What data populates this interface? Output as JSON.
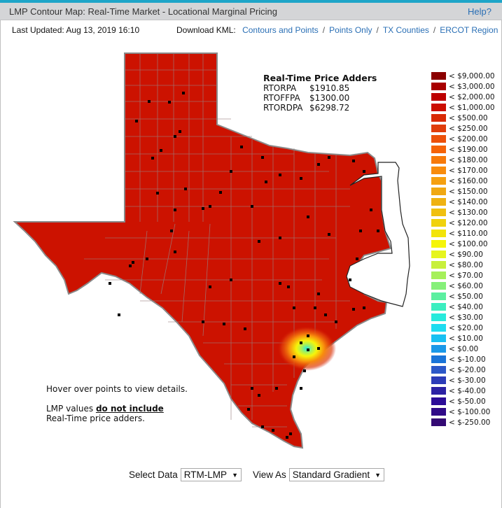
{
  "header": {
    "title": "LMP Contour Map: Real-Time Market - Locational Marginal Pricing",
    "help_label": "Help?"
  },
  "info": {
    "last_updated": "Last Updated: Aug 13, 2019 16:10",
    "download_label": "Download KML:",
    "links": [
      "Contours and Points",
      "Points Only",
      "TX Counties",
      "ERCOT Region"
    ]
  },
  "adders": {
    "title": "Real-Time Price Adders",
    "rows": [
      {
        "name": "RTORPA",
        "value": "$1910.85"
      },
      {
        "name": "RTOFFPA",
        "value": "$1300.00"
      },
      {
        "name": "RTORDPA",
        "value": "$6298.72"
      }
    ]
  },
  "legend": [
    {
      "label": "< $9,000.00",
      "color": "#8b0000"
    },
    {
      "label": "< $3,000.00",
      "color": "#a80000"
    },
    {
      "label": "< $2,000.00",
      "color": "#bd0000"
    },
    {
      "label": "< $1,000.00",
      "color": "#cc0e00"
    },
    {
      "label": "< $500.00",
      "color": "#d92a05"
    },
    {
      "label": "< $250.00",
      "color": "#e03d0b"
    },
    {
      "label": "< $200.00",
      "color": "#ec500a"
    },
    {
      "label": "< $190.00",
      "color": "#f56308"
    },
    {
      "label": "< $180.00",
      "color": "#f77a0a"
    },
    {
      "label": "< $170.00",
      "color": "#f88c0c"
    },
    {
      "label": "< $160.00",
      "color": "#f5a010"
    },
    {
      "label": "< $150.00",
      "color": "#f0a812"
    },
    {
      "label": "< $140.00",
      "color": "#efb212"
    },
    {
      "label": "< $130.00",
      "color": "#f0c010"
    },
    {
      "label": "< $120.00",
      "color": "#f0d20c"
    },
    {
      "label": "< $110.00",
      "color": "#f2e40a"
    },
    {
      "label": "< $100.00",
      "color": "#f5f50a"
    },
    {
      "label": "< $90.00",
      "color": "#e6f51e"
    },
    {
      "label": "< $80.00",
      "color": "#c8f03c"
    },
    {
      "label": "< $70.00",
      "color": "#a6f05a"
    },
    {
      "label": "< $60.00",
      "color": "#86f07a"
    },
    {
      "label": "< $50.00",
      "color": "#5cefa0"
    },
    {
      "label": "< $40.00",
      "color": "#3ceec0"
    },
    {
      "label": "< $30.00",
      "color": "#28eadc"
    },
    {
      "label": "< $20.00",
      "color": "#1edcf0"
    },
    {
      "label": "< $10.00",
      "color": "#18c0f2"
    },
    {
      "label": "< $0.00",
      "color": "#1a98e8"
    },
    {
      "label": "< $-10.00",
      "color": "#1a74d8"
    },
    {
      "label": "< $-20.00",
      "color": "#2c58c8"
    },
    {
      "label": "< $-30.00",
      "color": "#2c3cb8"
    },
    {
      "label": "< $-40.00",
      "color": "#2c22a4"
    },
    {
      "label": "< $-50.00",
      "color": "#2c0c98"
    },
    {
      "label": "< $-100.00",
      "color": "#300a88"
    },
    {
      "label": "< $-250.00",
      "color": "#340a74"
    }
  ],
  "map": {
    "base_color": "#cc1200",
    "outside_color": "#ffffff"
  },
  "notes": {
    "hover": "Hover over points to view details.",
    "lmp_prefix": "LMP values ",
    "lmp_bold": "do not include",
    "lmp_suffix": "Real-Time price adders."
  },
  "controls": {
    "select_data_label": "Select Data",
    "select_data_value": "RTM-LMP",
    "view_as_label": "View As",
    "view_as_value": "Standard Gradient"
  }
}
